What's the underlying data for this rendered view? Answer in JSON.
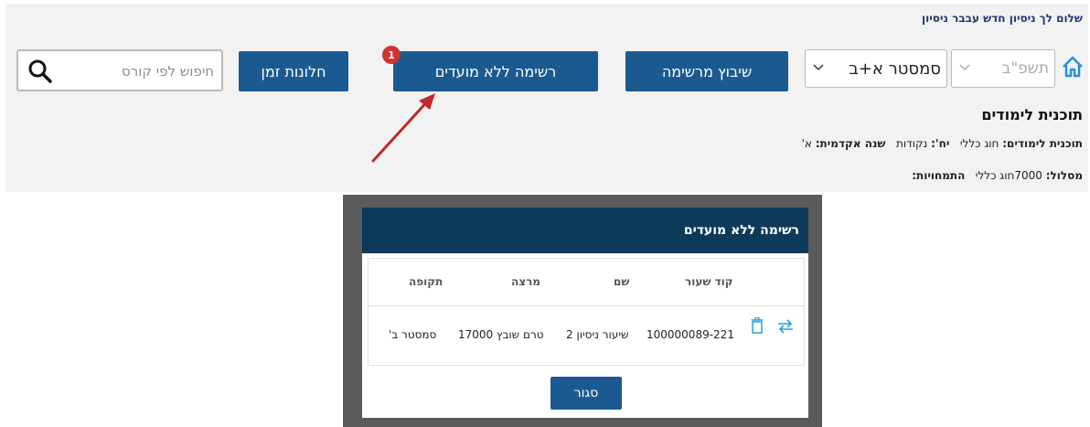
{
  "header": {
    "greeting": "שלום לך ניסיון חדש עבבר ניסיון"
  },
  "toolbar": {
    "year_select": "תשפ\"ב",
    "semester_select": "סמסטר א+ב",
    "build_from_list_label": "שיבוץ מרשימה",
    "no_exams_list_label": "רשימה ללא מועדים",
    "no_exams_badge": "1",
    "time_windows_label": "חלונות זמן",
    "search_placeholder": "חיפוש לפי קורס"
  },
  "plan": {
    "title": "תוכנית לימודים",
    "plan_label": "תוכנית לימודים:",
    "plan_value": "חוג כללי",
    "credits_label": "יח':",
    "credits_value": "נקודות",
    "year_label": "שנה אקדמית:",
    "year_value": "א'",
    "track_label": "מסלול:",
    "track_value": "7000חוג כללי",
    "specializations_label": "התמחויות:"
  },
  "modal": {
    "title": "רשימה ללא מועדים",
    "columns": [
      "קוד שעור",
      "שם",
      "מרצה",
      "תקופה"
    ],
    "rows": [
      {
        "code": "100000089-221",
        "name": "שיעור ניסיון 2",
        "lecturer": "טרם שובץ 17000",
        "period": "סמסטר ב'"
      }
    ],
    "close_label": "סגור"
  },
  "colors": {
    "primary_button": "#1a5a90",
    "modal_header": "#0e3a5a",
    "badge": "#cc3333",
    "annotation_arrow": "#c0282a"
  }
}
